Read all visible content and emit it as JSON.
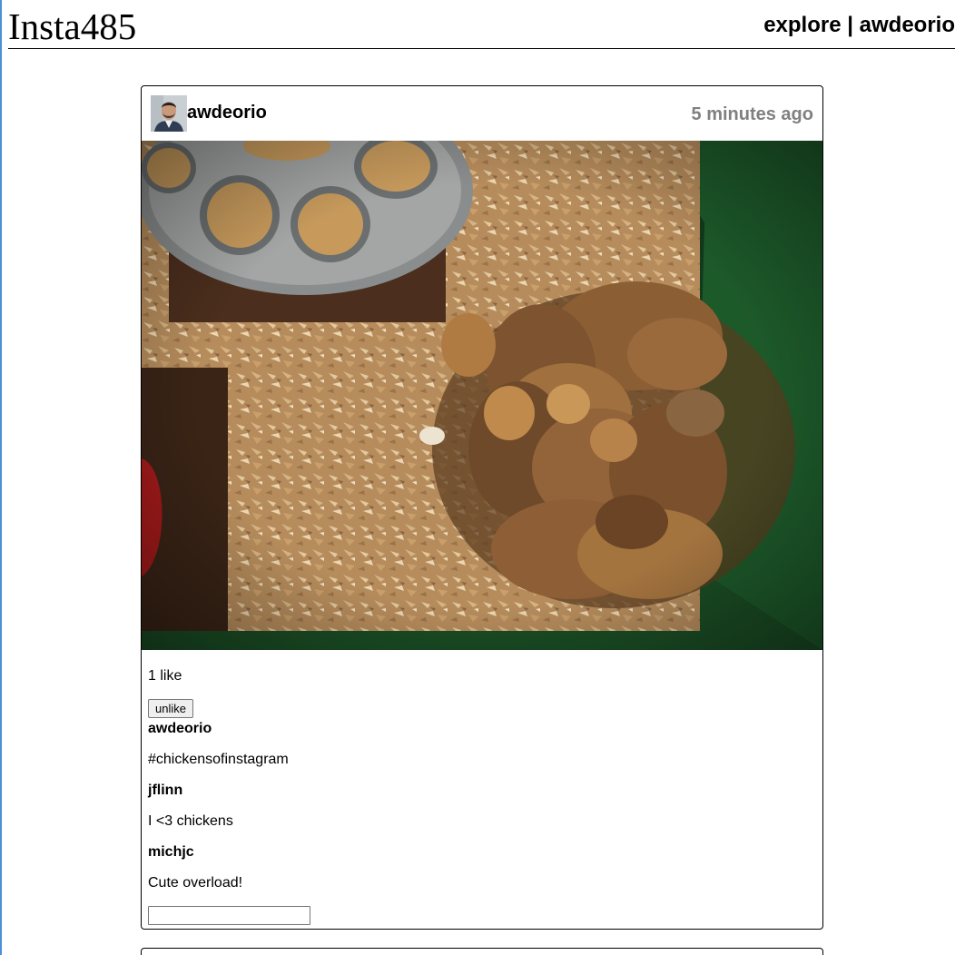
{
  "header": {
    "logo": "Insta485",
    "nav_explore": "explore",
    "nav_separator": "|",
    "nav_user": "awdeorio"
  },
  "post": {
    "owner": "awdeorio",
    "timestamp": "5 minutes ago",
    "likes_text": "1 like",
    "like_button_label": "unlike",
    "comments": [
      {
        "owner": "awdeorio",
        "text": "#chickensofinstagram"
      },
      {
        "owner": "jflinn",
        "text": "I <3 chickens"
      },
      {
        "owner": "michjc",
        "text": "Cute overload!"
      }
    ],
    "comment_input_value": ""
  },
  "colors": {
    "timestamp": "#808080",
    "left_edge": "#4a90d9"
  }
}
